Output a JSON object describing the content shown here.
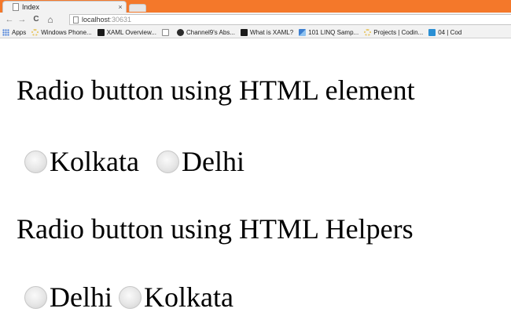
{
  "browser": {
    "tab": {
      "title": "Index",
      "close": "×"
    },
    "nav": {
      "back": "←",
      "forward": "→",
      "reload": "C",
      "home": "⌂"
    },
    "address": {
      "host": "localhost",
      "port": ":30631"
    },
    "bookmarks": [
      {
        "label": "Apps",
        "icon": "apps-grid-icon",
        "color": "#4a7fd9"
      },
      {
        "label": "Windows Phone...",
        "icon": "spinner-icon",
        "color": "#e8c86a"
      },
      {
        "label": "XAML Overview...",
        "icon": "msdn-icon",
        "color": "#1b1b1b"
      },
      {
        "label": "",
        "icon": "page-icon",
        "color": "#ffffff"
      },
      {
        "label": "Channel9's Abs...",
        "icon": "channel9-icon",
        "color": "#2b2b2b"
      },
      {
        "label": "What is XAML?",
        "icon": "msdn-icon",
        "color": "#1b1b1b"
      },
      {
        "label": "101 LINQ Samp...",
        "icon": "linq-icon",
        "color": "#3c7fd1"
      },
      {
        "label": "Projects | Codin...",
        "icon": "spinner-icon",
        "color": "#e8c86a"
      },
      {
        "label": "04 | Cod",
        "icon": "mva-icon",
        "color": "#2a8fd4"
      }
    ]
  },
  "page": {
    "heading1": "Radio button using HTML element",
    "group1": [
      "Kolkata",
      "Delhi"
    ],
    "heading2": "Radio button using HTML Helpers",
    "group2": [
      "Delhi",
      "Kolkata"
    ]
  }
}
